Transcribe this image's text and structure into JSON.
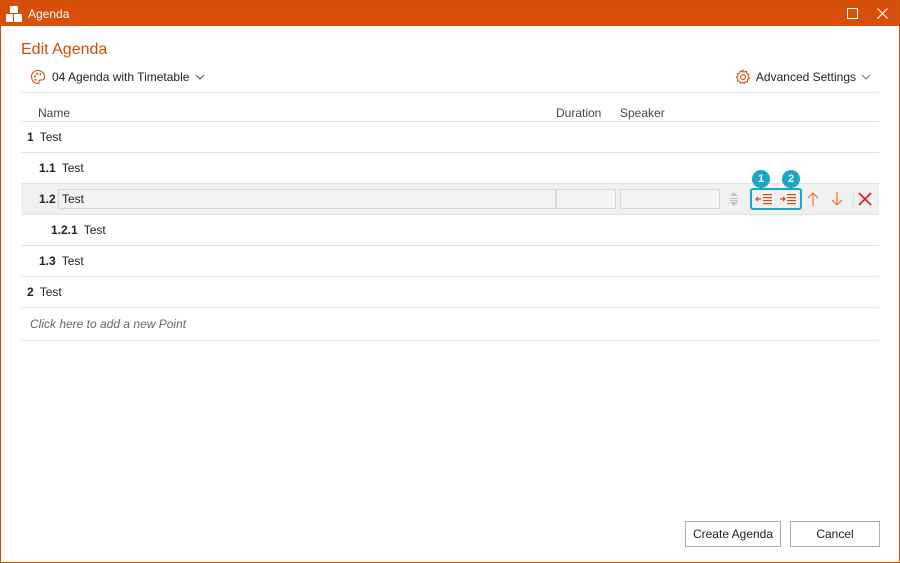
{
  "window": {
    "title": "Agenda",
    "accent_color": "#d94f09"
  },
  "heading": "Edit Agenda",
  "template_select": {
    "value": "04 Agenda with Timetable",
    "icon": "palette-icon"
  },
  "advanced_settings": {
    "label": "Advanced Settings",
    "icon": "gear-icon"
  },
  "columns": {
    "name": "Name",
    "duration": "Duration",
    "speaker": "Speaker"
  },
  "rows": [
    {
      "number": "1",
      "name": "Test",
      "level": 0
    },
    {
      "number": "1.1",
      "name": "Test",
      "level": 1
    },
    {
      "number": "1.2",
      "name": "Test",
      "level": 1,
      "selected": true
    },
    {
      "number": "1.2.1",
      "name": "Test",
      "level": 2
    },
    {
      "number": "1.3",
      "name": "Test",
      "level": 1
    },
    {
      "number": "2",
      "name": "Test",
      "level": 0
    }
  ],
  "annotations": {
    "badge1": "1",
    "badge2": "2",
    "highlight_color": "#19a7c9"
  },
  "add_point_placeholder": "Click here to add a new Point",
  "buttons": {
    "create": "Create Agenda",
    "cancel": "Cancel"
  }
}
